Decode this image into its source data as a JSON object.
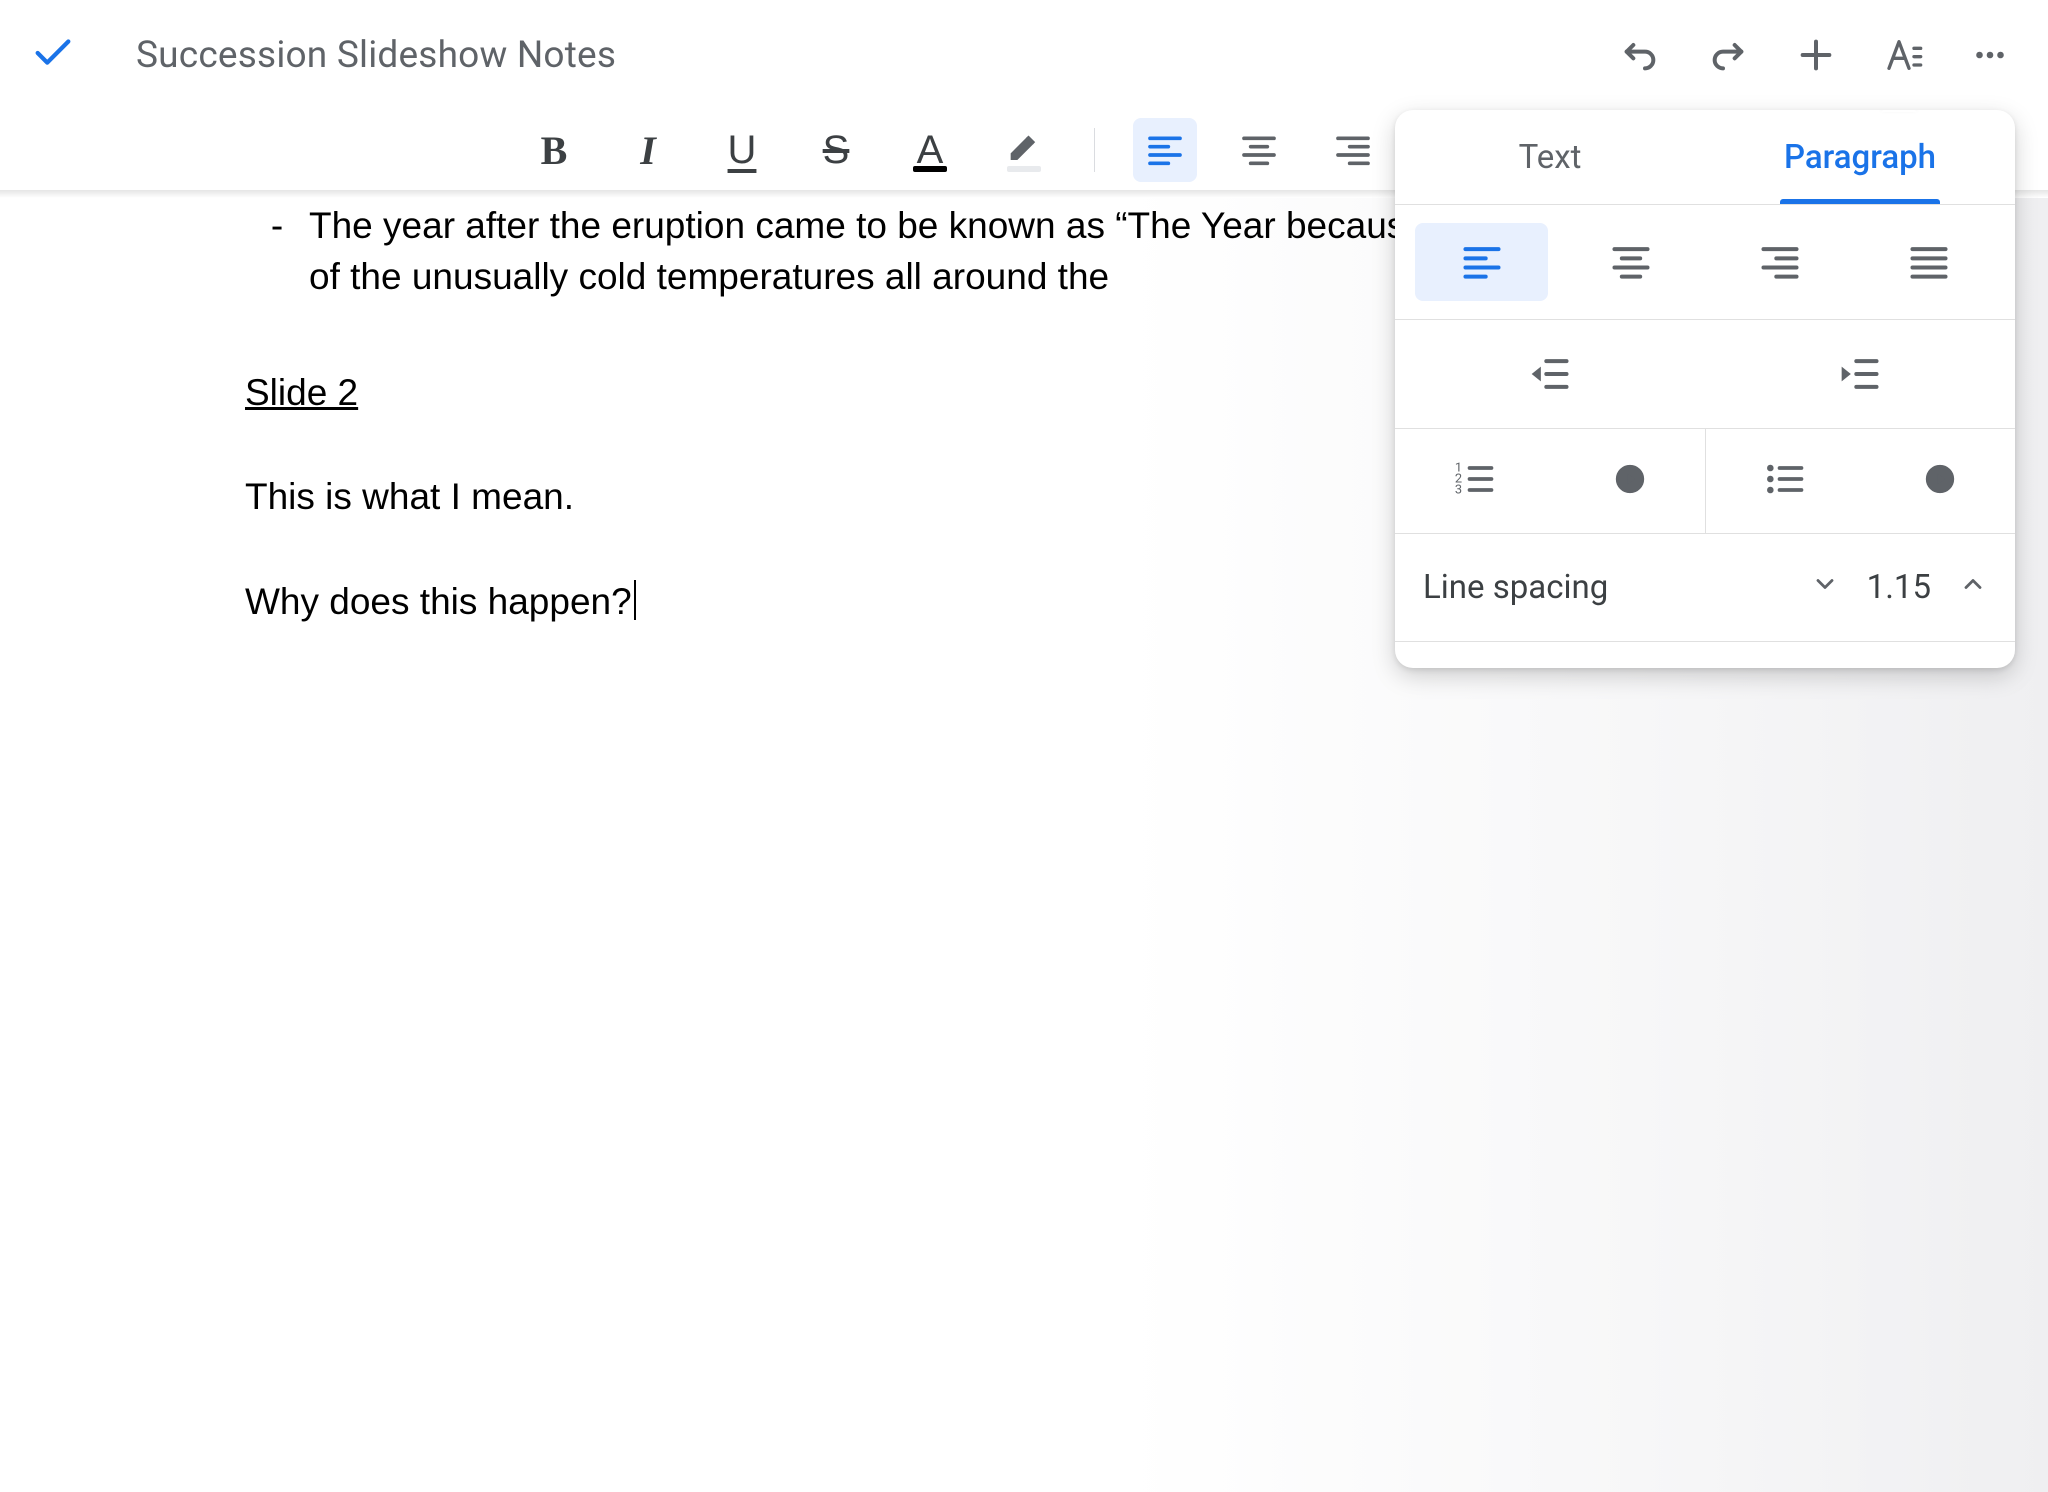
{
  "header": {
    "title": "Succession Slideshow Notes"
  },
  "document": {
    "bullet": {
      "marker": "-",
      "text": "The year after the eruption came to be known as “The Year because of the unusually cold temperatures all around the"
    },
    "heading": "Slide 2",
    "paragraph1": "This is what I mean.",
    "paragraph2": "Why does this happen?"
  },
  "panel": {
    "tabs": {
      "text": "Text",
      "paragraph": "Paragraph"
    },
    "line_spacing_label": "Line spacing",
    "line_spacing_value": "1.15"
  }
}
